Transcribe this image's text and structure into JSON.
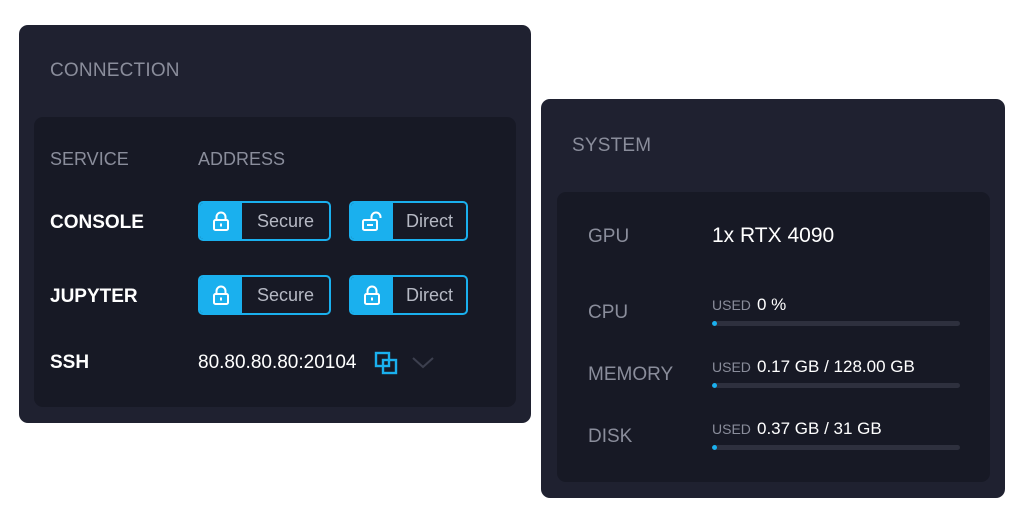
{
  "connection": {
    "title": "CONNECTION",
    "headers": {
      "service": "SERVICE",
      "address": "ADDRESS"
    },
    "services": [
      {
        "name": "CONSOLE",
        "secure_label": "Secure",
        "direct_label": "Direct",
        "secure_icon": "lock-closed-icon",
        "direct_icon": "lock-open-icon"
      },
      {
        "name": "JUPYTER",
        "secure_label": "Secure",
        "direct_label": "Direct",
        "secure_icon": "lock-closed-icon",
        "direct_icon": "lock-closed-icon"
      }
    ],
    "ssh": {
      "name": "SSH",
      "address": "80.80.80.80:20104",
      "copy_icon": "copy-icon",
      "expand_icon": "chevron-down-icon"
    }
  },
  "system": {
    "title": "SYSTEM",
    "gpu": {
      "label": "GPU",
      "value": "1x RTX 4090"
    },
    "cpu": {
      "label": "CPU",
      "used_tag": "USED",
      "value": "0 %",
      "fraction": 0.0
    },
    "memory": {
      "label": "MEMORY",
      "used_tag": "USED",
      "value": "0.17 GB / 128.00 GB",
      "fraction": 0.0013
    },
    "disk": {
      "label": "DISK",
      "used_tag": "USED",
      "value": "0.37 GB / 31 GB",
      "fraction": 0.012
    }
  },
  "colors": {
    "accent": "#1ab0ee",
    "panel_bg": "#1f2130",
    "inner_bg": "#171925",
    "muted_text": "#8a8d9b"
  }
}
